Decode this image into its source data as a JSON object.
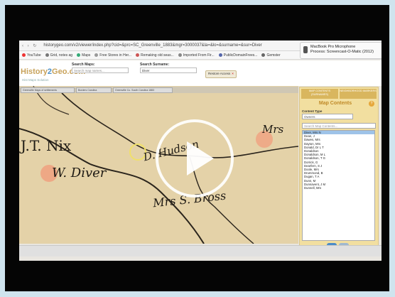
{
  "browser": {
    "url": "historygeo.com/v2/viewer/index.php?cid=&prc=SC_Greenville_1883&mgr=3000037&la=&lo=&surname=&sur=Diver",
    "bookmarks": [
      "YouTube",
      "Grid, notes ag",
      "Maps",
      "Free Stores in Her...",
      "Remaking old seas...",
      "Imported From Fir...",
      "PublicDomainFrees...",
      "Gemster"
    ]
  },
  "notification": {
    "title": "MacBook Pro Microphone",
    "body": "Process: Screencast-O-Matic (2012)"
  },
  "header": {
    "logo_a": "History",
    "logo_two": "2",
    "logo_b": "Geo.com",
    "tagline": "Hist Maps Solution",
    "search_maps_label": "Search Maps:",
    "search_maps_placeholder": "Search map names...",
    "search_surname_label": "Search Surname:",
    "search_surname_value": "Diver",
    "access_label": "Restore Access",
    "access_close": "×"
  },
  "map_tabs": [
    "Greenville Maps of settlements",
    "Borders Carolina",
    "Greenville Co. South Carolina 1883"
  ],
  "map_labels": {
    "nix": "J.T. Nix",
    "diver": "W. Diver",
    "hudson": "D. Hudson",
    "mrs": "Mrs",
    "mrs_bross": "Mrs S. Bross"
  },
  "panel": {
    "tab_1": "MAP CONTENTS (SURNAMES)",
    "tab_2": "NEIGHBORHOOD MARKERS",
    "title": "Map Contents",
    "help_icon": "?",
    "content_type_label": "Content Type",
    "content_type_value": "Owners",
    "search_placeholder": "Search Map Contents...",
    "items": [
      "Diver, Mrs N",
      "Dean, J",
      "Dawes, Mrs",
      "Dayton, Mrs",
      "Donald, Dr L T",
      "Donaldson",
      "Donaldson, M L",
      "Donaldson, T G",
      "Dorrick, G",
      "Dearfern, S J",
      "Doole, Mrs",
      "Drummond, B",
      "Dugan, T A",
      "Dunn, M",
      "Dunnavent, J M",
      "Dunnell, Mrs"
    ],
    "selected_index": 0
  },
  "colors": {
    "frame": "#050505",
    "page": "#cfe4ee",
    "map_paper": "#e2cfa4",
    "panel": "#f2dfa0",
    "accent_blue": "#4b8cc8",
    "marker_orange": "#f29a7a"
  },
  "icons": {
    "play": "play-icon",
    "zoom": "search-icon",
    "gear": "settings-icon"
  }
}
